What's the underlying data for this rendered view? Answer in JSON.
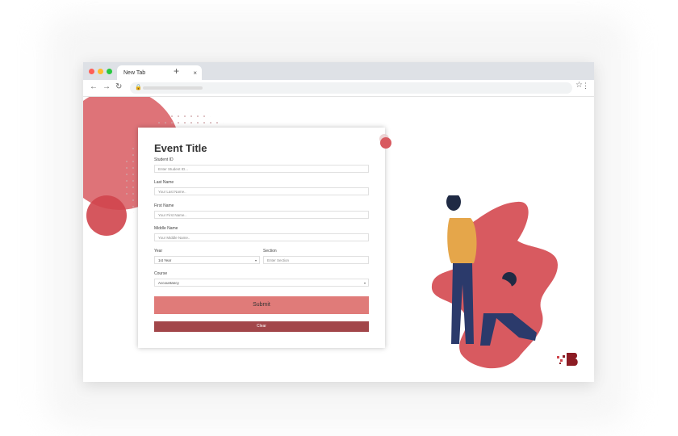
{
  "browser": {
    "tab_title": "New Tab",
    "tab_close": "×",
    "new_tab": "+"
  },
  "form": {
    "title": "Event Title",
    "student_id": {
      "label": "Student ID",
      "placeholder": "Enter Student ID..."
    },
    "last_name": {
      "label": "Last Name",
      "placeholder": "Your Last Name.."
    },
    "first_name": {
      "label": "First Name",
      "placeholder": "Your First Name.."
    },
    "middle_name": {
      "label": "Middle Name",
      "placeholder": "Your Middle Name.."
    },
    "year": {
      "label": "Year",
      "value": "1st Year"
    },
    "section": {
      "label": "Section",
      "placeholder": "Enter Section"
    },
    "course": {
      "label": "Course",
      "value": "Accountancy"
    },
    "submit_label": "Submit",
    "clear_label": "Clear"
  },
  "colors": {
    "accent": "#d85a60",
    "submit_bg": "#e07b79",
    "clear_bg": "#a2464a"
  }
}
